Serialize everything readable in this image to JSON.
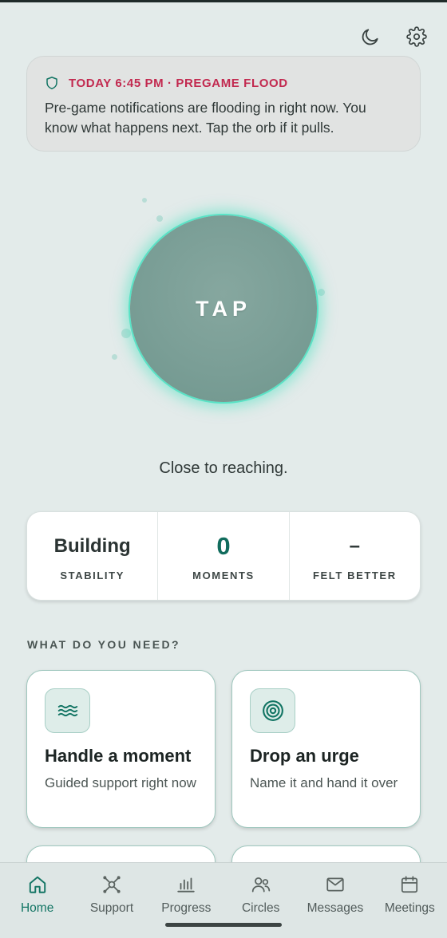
{
  "alert": {
    "title": "TODAY 6:45 PM · PREGAME FLOOD",
    "body": "Pre-game notifications are flooding in right now. You know what happens next. Tap the orb if it pulls."
  },
  "orb": {
    "label": "TAP"
  },
  "status_text": "Close to reaching.",
  "stats": [
    {
      "value": "Building",
      "label": "STABILITY"
    },
    {
      "value": "0",
      "label": "MOMENTS"
    },
    {
      "value": "–",
      "label": "FELT BETTER"
    }
  ],
  "section_title": "WHAT DO YOU NEED?",
  "cards": [
    {
      "title": "Handle a moment",
      "subtitle": "Guided support right now",
      "icon": "waves-icon"
    },
    {
      "title": "Drop an urge",
      "subtitle": "Name it and hand it over",
      "icon": "target-icon"
    }
  ],
  "nav": [
    {
      "label": "Home",
      "icon": "home-icon",
      "active": true
    },
    {
      "label": "Support",
      "icon": "support-icon"
    },
    {
      "label": "Progress",
      "icon": "progress-chart-icon"
    },
    {
      "label": "Circles",
      "icon": "people-icon"
    },
    {
      "label": "Messages",
      "icon": "mail-icon"
    },
    {
      "label": "Meetings",
      "icon": "calendar-icon"
    }
  ],
  "colors": {
    "accent": "#116c5d",
    "alert": "#c2294f",
    "orb_glow": "#59e3c6",
    "background": "#e3ebea"
  }
}
